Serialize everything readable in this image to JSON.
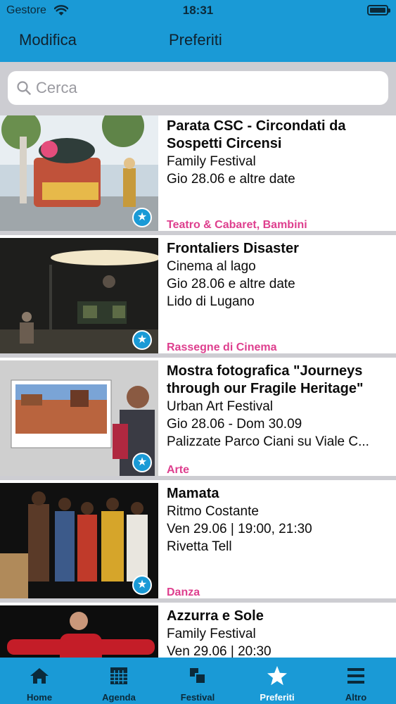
{
  "status_bar": {
    "carrier": "Gestore",
    "time": "18:31"
  },
  "nav": {
    "left_label": "Modifica",
    "title": "Preferiti"
  },
  "search": {
    "placeholder": "Cerca",
    "value": ""
  },
  "events": [
    {
      "title": "Parata CSC - Circondati da\nSospetti Circensi",
      "festival": "Family Festival",
      "date": "Gio 28.06 e altre date",
      "location": "",
      "category": "Teatro & Cabaret, Bambini",
      "favorite": true
    },
    {
      "title": "Frontaliers Disaster",
      "festival": "Cinema al lago",
      "date": "Gio 28.06 e altre date",
      "location": "Lido di Lugano",
      "category": "Rassegne di Cinema",
      "favorite": true
    },
    {
      "title": "Mostra fotografica \"Journeys\nthrough our Fragile Heritage\"",
      "festival": "Urban Art Festival",
      "date": "Gio 28.06 - Dom 30.09",
      "location": "Palizzate Parco Ciani su Viale C...",
      "category": "Arte",
      "favorite": true
    },
    {
      "title": "Mamata",
      "festival": "Ritmo Costante",
      "date": "Ven 29.06 | 19:00, 21:30",
      "location": "Rivetta Tell",
      "category": "Danza",
      "favorite": true
    },
    {
      "title": "Azzurra e Sole",
      "festival": "Family Festival",
      "date": "Ven 29.06 | 20:30",
      "location": "",
      "category": "",
      "favorite": true
    }
  ],
  "tabs": [
    {
      "label": "Home",
      "icon": "home-icon",
      "active": false
    },
    {
      "label": "Agenda",
      "icon": "calendar-grid-icon",
      "active": false
    },
    {
      "label": "Festival",
      "icon": "festival-squares-icon",
      "active": false
    },
    {
      "label": "Preferiti",
      "icon": "star-icon",
      "active": true
    },
    {
      "label": "Altro",
      "icon": "menu-icon",
      "active": false
    }
  ],
  "colors": {
    "accent": "#1a9ad6",
    "category": "#de3f8e",
    "separator": "#cdcdd2",
    "tab_inactive": "#0b2a3a",
    "tab_active": "#ffffff"
  }
}
